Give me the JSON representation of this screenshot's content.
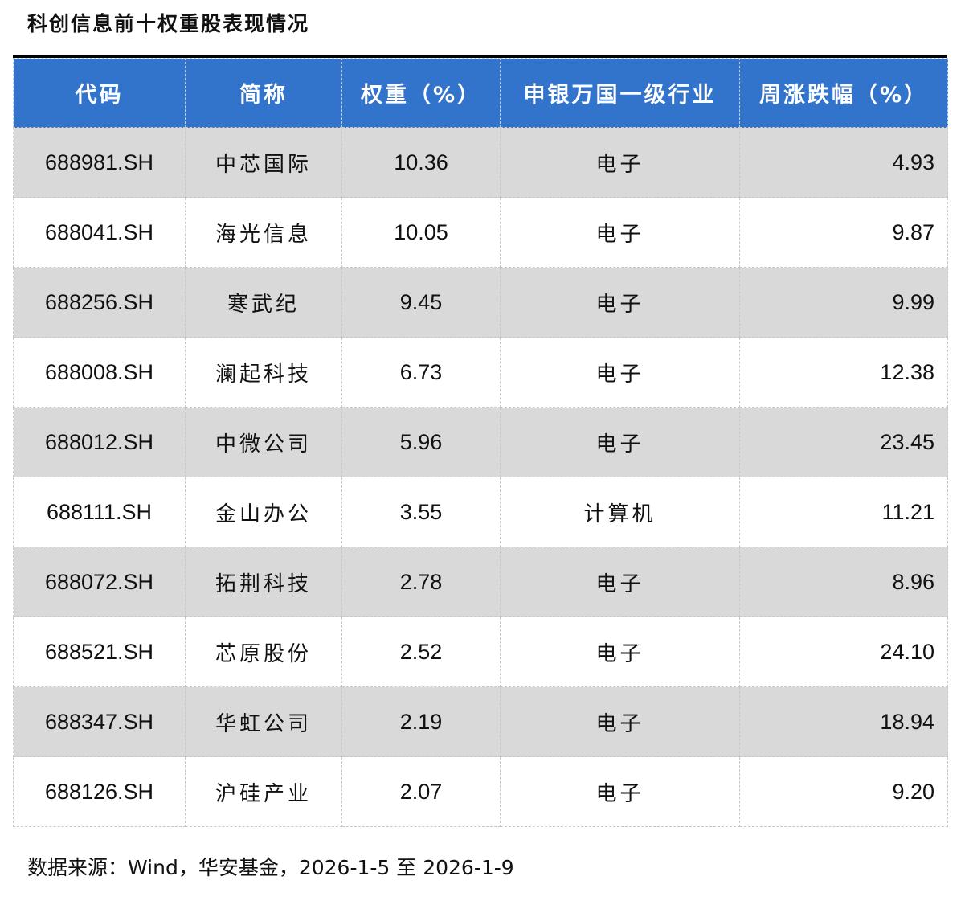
{
  "title": "科创信息前十权重股表现情况",
  "headers": [
    "代码",
    "简称",
    "权重（%）",
    "申银万国一级行业",
    "周涨跌幅（%）"
  ],
  "rows": [
    [
      "688981.SH",
      "中芯国际",
      "10.36",
      "电子",
      "4.93"
    ],
    [
      "688041.SH",
      "海光信息",
      "10.05",
      "电子",
      "9.87"
    ],
    [
      "688256.SH",
      "寒武纪",
      "9.45",
      "电子",
      "9.99"
    ],
    [
      "688008.SH",
      "澜起科技",
      "6.73",
      "电子",
      "12.38"
    ],
    [
      "688012.SH",
      "中微公司",
      "5.96",
      "电子",
      "23.45"
    ],
    [
      "688111.SH",
      "金山办公",
      "3.55",
      "计算机",
      "11.21"
    ],
    [
      "688072.SH",
      "拓荆科技",
      "2.78",
      "电子",
      "8.96"
    ],
    [
      "688521.SH",
      "芯原股份",
      "2.52",
      "电子",
      "24.10"
    ],
    [
      "688347.SH",
      "华虹公司",
      "2.19",
      "电子",
      "18.94"
    ],
    [
      "688126.SH",
      "沪硅产业",
      "2.07",
      "电子",
      "9.20"
    ]
  ],
  "source": "数据来源：Wind，华安基金，2026-1-5 至 2026-1-9"
}
